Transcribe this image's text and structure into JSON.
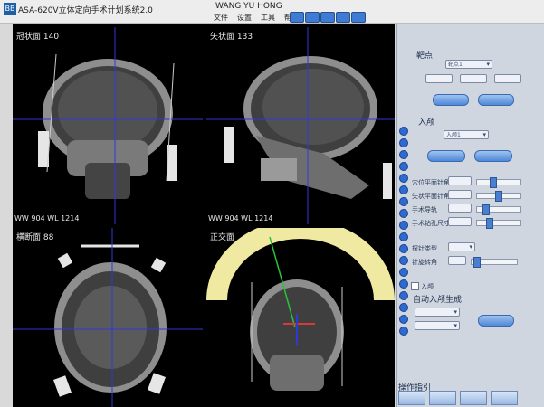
{
  "app": {
    "title": "ASA-620V立体定向手术计划系统2.0",
    "logo": "BB",
    "user": "WANG YU HONG",
    "menu": [
      "文件",
      "设置",
      "工具",
      "帮助"
    ]
  },
  "viewports": [
    {
      "label": "冠状面 140",
      "wwwl": "WW 904  WL 1214"
    },
    {
      "label": "矢状面 133",
      "wwwl": "WW 904  WL 1214"
    },
    {
      "label": "横断面 88",
      "wwwl": ""
    },
    {
      "label": "正交面",
      "wwwl": ""
    }
  ],
  "panel": {
    "target": {
      "title": "靶点",
      "select_value": "靶点1"
    },
    "entry": {
      "title": "入颅",
      "select_value": "入颅1",
      "rows": [
        {
          "label": "穴位平面针角"
        },
        {
          "label": "矢状平面针角"
        },
        {
          "label": "手术导轨"
        },
        {
          "label": "手术钻孔尺寸"
        }
      ],
      "probe": {
        "label": "探针类型"
      },
      "rotate": {
        "label": "针旋转角"
      }
    },
    "auto": {
      "checkbox_label": "入颅",
      "title": "自动入颅生成"
    },
    "ops": {
      "title": "操作指引"
    }
  },
  "colors": {
    "panel_bg": "#cfd6e0",
    "accent": "#3e7bd3",
    "frame_yellow": "#efe9a2",
    "crosshair": "#2f39d6"
  }
}
